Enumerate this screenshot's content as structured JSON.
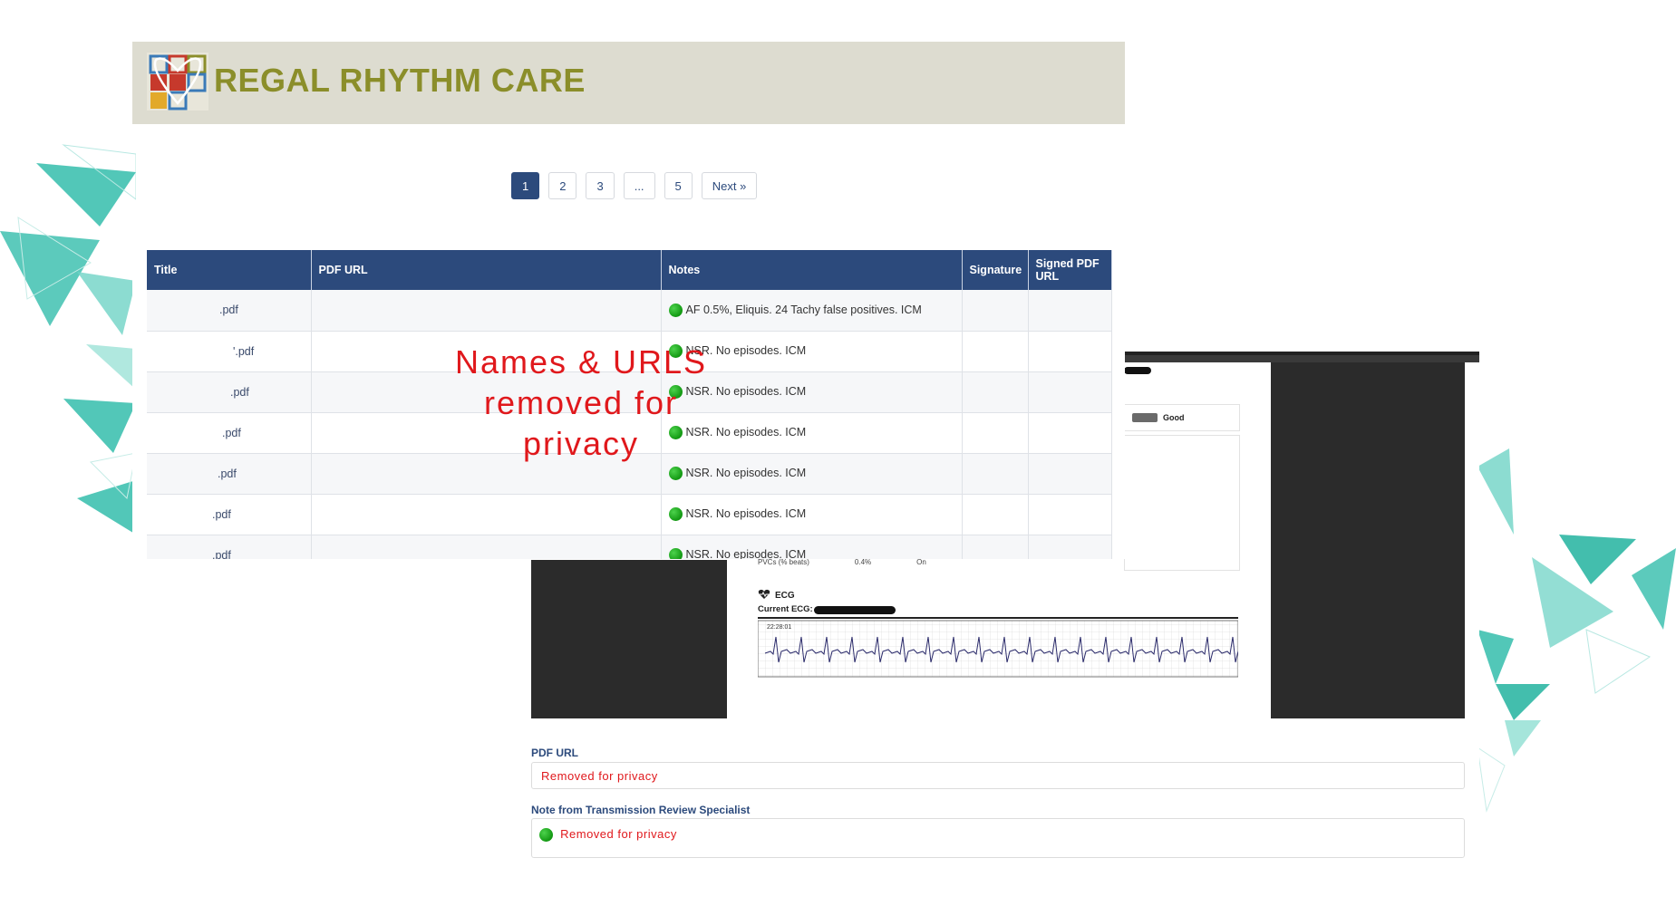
{
  "brand": {
    "name": "REGAL RHYTHM CARE",
    "colors": {
      "olive": "#8b8e2a",
      "banner_bg": "#dddcd0",
      "navy": "#2c4a7c"
    }
  },
  "pagination": {
    "pages": [
      "1",
      "2",
      "3",
      "...",
      "5"
    ],
    "active": "1",
    "next_label": "Next »"
  },
  "table": {
    "headers": [
      "Title",
      "PDF URL",
      "Notes",
      "Signature",
      "Signed PDF URL"
    ],
    "rows": [
      {
        "title": ".pdf",
        "note": "AF 0.5%, Eliquis. 24 Tachy false positives. ICM"
      },
      {
        "title": "'.pdf",
        "note": "NSR. No episodes. ICM"
      },
      {
        "title": ".pdf",
        "note": "NSR. No episodes. ICM"
      },
      {
        "title": ".pdf",
        "note": "NSR. No episodes. ICM"
      },
      {
        "title": ".pdf",
        "note": "NSR. No episodes. ICM"
      },
      {
        "title": ".pdf",
        "note": "NSR. No episodes. ICM"
      },
      {
        "title": ".pdf",
        "note": "NSR. No episodes. ICM"
      }
    ],
    "status_icon": "green-dot-icon"
  },
  "privacy_overlay": "Names & URLS removed for privacy",
  "report": {
    "battery_label": "Good",
    "pvc_label": "PVCs (% beats)",
    "pvc_value": "0.4%",
    "pvc_state": "On",
    "ecg_heading": "ECG",
    "ecg_current_label": "Current ECG:",
    "ecg_time": "22:28:01",
    "pdf_url_label": "PDF URL",
    "pdf_url_value": "Removed for privacy",
    "note_label": "Note from Transmission Review Specialist",
    "note_value": "Removed for privacy"
  }
}
